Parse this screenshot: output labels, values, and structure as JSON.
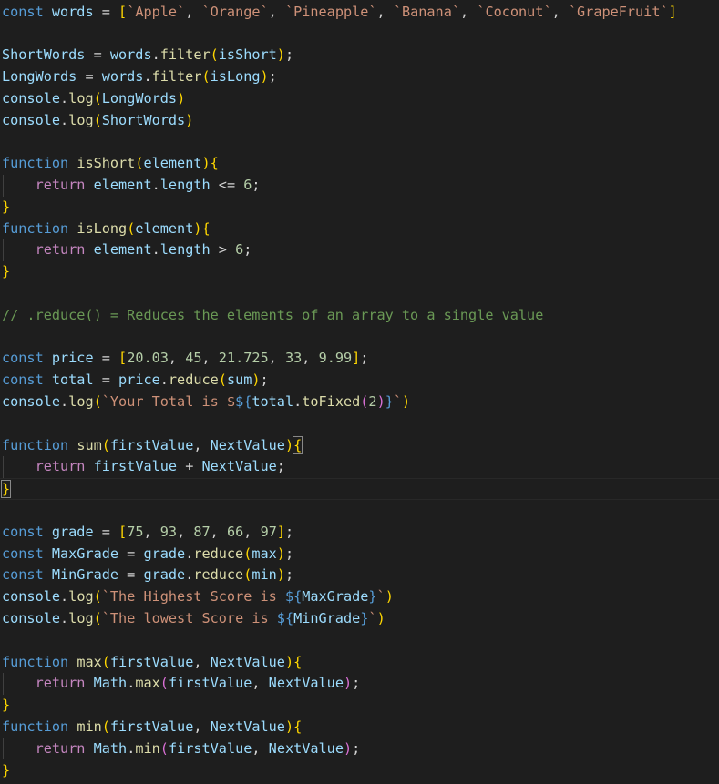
{
  "colors": {
    "background": "#1e1e1e",
    "default": "#d4d4d4",
    "keyword": "#569cd6",
    "control": "#c586c0",
    "variable": "#9cdcfe",
    "function": "#dcdcaa",
    "string": "#ce9178",
    "number": "#b5cea8",
    "comment": "#6a9955",
    "bracket1": "#ffd700",
    "bracket2": "#da70d6",
    "bracket3": "#179fff"
  },
  "lines": [
    [
      [
        "keyword",
        "const"
      ],
      [
        "default",
        " "
      ],
      [
        "variable",
        "words"
      ],
      [
        "default",
        " = "
      ],
      [
        "bracket1",
        "["
      ],
      [
        "string",
        "`Apple`"
      ],
      [
        "default",
        ", "
      ],
      [
        "string",
        "`Orange`"
      ],
      [
        "default",
        ", "
      ],
      [
        "string",
        "`Pineapple`"
      ],
      [
        "default",
        ", "
      ],
      [
        "string",
        "`Banana`"
      ],
      [
        "default",
        ", "
      ],
      [
        "string",
        "`Coconut`"
      ],
      [
        "default",
        ", "
      ],
      [
        "string",
        "`GrapeFruit`"
      ],
      [
        "bracket1",
        "]"
      ]
    ],
    [],
    [
      [
        "variable",
        "ShortWords"
      ],
      [
        "default",
        " = "
      ],
      [
        "variable",
        "words"
      ],
      [
        "default",
        "."
      ],
      [
        "function",
        "filter"
      ],
      [
        "bracket1",
        "("
      ],
      [
        "variable",
        "isShort"
      ],
      [
        "bracket1",
        ")"
      ],
      [
        "default",
        ";"
      ]
    ],
    [
      [
        "variable",
        "LongWords"
      ],
      [
        "default",
        " = "
      ],
      [
        "variable",
        "words"
      ],
      [
        "default",
        "."
      ],
      [
        "function",
        "filter"
      ],
      [
        "bracket1",
        "("
      ],
      [
        "variable",
        "isLong"
      ],
      [
        "bracket1",
        ")"
      ],
      [
        "default",
        ";"
      ]
    ],
    [
      [
        "variable",
        "console"
      ],
      [
        "default",
        "."
      ],
      [
        "function",
        "log"
      ],
      [
        "bracket1",
        "("
      ],
      [
        "variable",
        "LongWords"
      ],
      [
        "bracket1",
        ")"
      ]
    ],
    [
      [
        "variable",
        "console"
      ],
      [
        "default",
        "."
      ],
      [
        "function",
        "log"
      ],
      [
        "bracket1",
        "("
      ],
      [
        "variable",
        "ShortWords"
      ],
      [
        "bracket1",
        ")"
      ]
    ],
    [],
    [
      [
        "keyword",
        "function"
      ],
      [
        "default",
        " "
      ],
      [
        "function",
        "isShort"
      ],
      [
        "bracket1",
        "("
      ],
      [
        "variable",
        "element"
      ],
      [
        "bracket1",
        ")"
      ],
      [
        "bracket1",
        "{"
      ]
    ],
    [
      [
        "default",
        "    "
      ],
      [
        "control",
        "return"
      ],
      [
        "default",
        " "
      ],
      [
        "variable",
        "element"
      ],
      [
        "default",
        "."
      ],
      [
        "variable",
        "length"
      ],
      [
        "default",
        " <= "
      ],
      [
        "number",
        "6"
      ],
      [
        "default",
        ";"
      ]
    ],
    [
      [
        "bracket1",
        "}"
      ]
    ],
    [
      [
        "keyword",
        "function"
      ],
      [
        "default",
        " "
      ],
      [
        "function",
        "isLong"
      ],
      [
        "bracket1",
        "("
      ],
      [
        "variable",
        "element"
      ],
      [
        "bracket1",
        ")"
      ],
      [
        "bracket1",
        "{"
      ]
    ],
    [
      [
        "default",
        "    "
      ],
      [
        "control",
        "return"
      ],
      [
        "default",
        " "
      ],
      [
        "variable",
        "element"
      ],
      [
        "default",
        "."
      ],
      [
        "variable",
        "length"
      ],
      [
        "default",
        " > "
      ],
      [
        "number",
        "6"
      ],
      [
        "default",
        ";"
      ]
    ],
    [
      [
        "bracket1",
        "}"
      ]
    ],
    [],
    [
      [
        "comment",
        "// .reduce() = Reduces the elements of an array to a single value"
      ]
    ],
    [],
    [
      [
        "keyword",
        "const"
      ],
      [
        "default",
        " "
      ],
      [
        "variable",
        "price"
      ],
      [
        "default",
        " = "
      ],
      [
        "bracket1",
        "["
      ],
      [
        "number",
        "20.03"
      ],
      [
        "default",
        ", "
      ],
      [
        "number",
        "45"
      ],
      [
        "default",
        ", "
      ],
      [
        "number",
        "21.725"
      ],
      [
        "default",
        ", "
      ],
      [
        "number",
        "33"
      ],
      [
        "default",
        ", "
      ],
      [
        "number",
        "9.99"
      ],
      [
        "bracket1",
        "]"
      ],
      [
        "default",
        ";"
      ]
    ],
    [
      [
        "keyword",
        "const"
      ],
      [
        "default",
        " "
      ],
      [
        "variable",
        "total"
      ],
      [
        "default",
        " = "
      ],
      [
        "variable",
        "price"
      ],
      [
        "default",
        "."
      ],
      [
        "function",
        "reduce"
      ],
      [
        "bracket1",
        "("
      ],
      [
        "variable",
        "sum"
      ],
      [
        "bracket1",
        ")"
      ],
      [
        "default",
        ";"
      ]
    ],
    [
      [
        "variable",
        "console"
      ],
      [
        "default",
        "."
      ],
      [
        "function",
        "log"
      ],
      [
        "bracket1",
        "("
      ],
      [
        "string",
        "`Your Total is $"
      ],
      [
        "keyword",
        "${"
      ],
      [
        "variable",
        "total"
      ],
      [
        "default",
        "."
      ],
      [
        "function",
        "toFixed"
      ],
      [
        "bracket2",
        "("
      ],
      [
        "number",
        "2"
      ],
      [
        "bracket2",
        ")"
      ],
      [
        "keyword",
        "}"
      ],
      [
        "string",
        "`"
      ],
      [
        "bracket1",
        ")"
      ]
    ],
    [],
    [
      [
        "keyword",
        "function"
      ],
      [
        "default",
        " "
      ],
      [
        "function",
        "sum"
      ],
      [
        "bracket1",
        "("
      ],
      [
        "variable",
        "firstValue"
      ],
      [
        "default",
        ", "
      ],
      [
        "variable",
        "NextValue"
      ],
      [
        "bracket1",
        ")"
      ],
      [
        "bracket1",
        "{"
      ]
    ],
    [
      [
        "default",
        "    "
      ],
      [
        "control",
        "return"
      ],
      [
        "default",
        " "
      ],
      [
        "variable",
        "firstValue"
      ],
      [
        "default",
        " + "
      ],
      [
        "variable",
        "NextValue"
      ],
      [
        "default",
        ";"
      ]
    ],
    [
      [
        "bracket1",
        "}"
      ]
    ],
    [],
    [
      [
        "keyword",
        "const"
      ],
      [
        "default",
        " "
      ],
      [
        "variable",
        "grade"
      ],
      [
        "default",
        " = "
      ],
      [
        "bracket1",
        "["
      ],
      [
        "number",
        "75"
      ],
      [
        "default",
        ", "
      ],
      [
        "number",
        "93"
      ],
      [
        "default",
        ", "
      ],
      [
        "number",
        "87"
      ],
      [
        "default",
        ", "
      ],
      [
        "number",
        "66"
      ],
      [
        "default",
        ", "
      ],
      [
        "number",
        "97"
      ],
      [
        "bracket1",
        "]"
      ],
      [
        "default",
        ";"
      ]
    ],
    [
      [
        "keyword",
        "const"
      ],
      [
        "default",
        " "
      ],
      [
        "variable",
        "MaxGrade"
      ],
      [
        "default",
        " = "
      ],
      [
        "variable",
        "grade"
      ],
      [
        "default",
        "."
      ],
      [
        "function",
        "reduce"
      ],
      [
        "bracket1",
        "("
      ],
      [
        "variable",
        "max"
      ],
      [
        "bracket1",
        ")"
      ],
      [
        "default",
        ";"
      ]
    ],
    [
      [
        "keyword",
        "const"
      ],
      [
        "default",
        " "
      ],
      [
        "variable",
        "MinGrade"
      ],
      [
        "default",
        " = "
      ],
      [
        "variable",
        "grade"
      ],
      [
        "default",
        "."
      ],
      [
        "function",
        "reduce"
      ],
      [
        "bracket1",
        "("
      ],
      [
        "variable",
        "min"
      ],
      [
        "bracket1",
        ")"
      ],
      [
        "default",
        ";"
      ]
    ],
    [
      [
        "variable",
        "console"
      ],
      [
        "default",
        "."
      ],
      [
        "function",
        "log"
      ],
      [
        "bracket1",
        "("
      ],
      [
        "string",
        "`The Highest Score is "
      ],
      [
        "keyword",
        "${"
      ],
      [
        "variable",
        "MaxGrade"
      ],
      [
        "keyword",
        "}"
      ],
      [
        "string",
        "`"
      ],
      [
        "bracket1",
        ")"
      ]
    ],
    [
      [
        "variable",
        "console"
      ],
      [
        "default",
        "."
      ],
      [
        "function",
        "log"
      ],
      [
        "bracket1",
        "("
      ],
      [
        "string",
        "`The lowest Score is "
      ],
      [
        "keyword",
        "${"
      ],
      [
        "variable",
        "MinGrade"
      ],
      [
        "keyword",
        "}"
      ],
      [
        "string",
        "`"
      ],
      [
        "bracket1",
        ")"
      ]
    ],
    [],
    [
      [
        "keyword",
        "function"
      ],
      [
        "default",
        " "
      ],
      [
        "function",
        "max"
      ],
      [
        "bracket1",
        "("
      ],
      [
        "variable",
        "firstValue"
      ],
      [
        "default",
        ", "
      ],
      [
        "variable",
        "NextValue"
      ],
      [
        "bracket1",
        ")"
      ],
      [
        "bracket1",
        "{"
      ]
    ],
    [
      [
        "default",
        "    "
      ],
      [
        "control",
        "return"
      ],
      [
        "default",
        " "
      ],
      [
        "variable",
        "Math"
      ],
      [
        "default",
        "."
      ],
      [
        "function",
        "max"
      ],
      [
        "bracket2",
        "("
      ],
      [
        "variable",
        "firstValue"
      ],
      [
        "default",
        ", "
      ],
      [
        "variable",
        "NextValue"
      ],
      [
        "bracket2",
        ")"
      ],
      [
        "default",
        ";"
      ]
    ],
    [
      [
        "bracket1",
        "}"
      ]
    ],
    [
      [
        "keyword",
        "function"
      ],
      [
        "default",
        " "
      ],
      [
        "function",
        "min"
      ],
      [
        "bracket1",
        "("
      ],
      [
        "variable",
        "firstValue"
      ],
      [
        "default",
        ", "
      ],
      [
        "variable",
        "NextValue"
      ],
      [
        "bracket1",
        ")"
      ],
      [
        "bracket1",
        "{"
      ]
    ],
    [
      [
        "default",
        "    "
      ],
      [
        "control",
        "return"
      ],
      [
        "default",
        " "
      ],
      [
        "variable",
        "Math"
      ],
      [
        "default",
        "."
      ],
      [
        "function",
        "min"
      ],
      [
        "bracket2",
        "("
      ],
      [
        "variable",
        "firstValue"
      ],
      [
        "default",
        ", "
      ],
      [
        "variable",
        "NextValue"
      ],
      [
        "bracket2",
        ")"
      ],
      [
        "default",
        ";"
      ]
    ],
    [
      [
        "bracket1",
        "}"
      ]
    ]
  ]
}
